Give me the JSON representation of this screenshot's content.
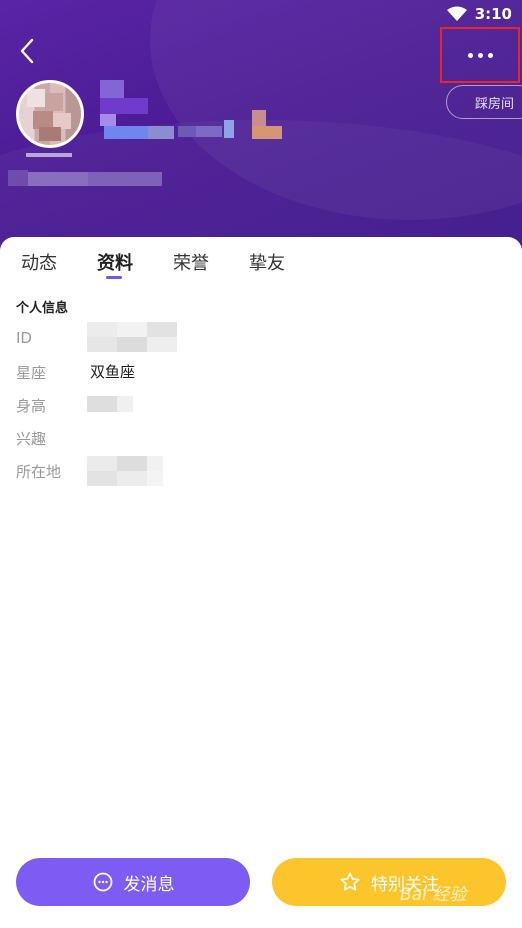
{
  "status_bar": {
    "time": "3:10"
  },
  "header": {
    "room_button_label": "踩房间"
  },
  "tabs": [
    {
      "label": "动态",
      "active": false
    },
    {
      "label": "资料",
      "active": true
    },
    {
      "label": "荣誉",
      "active": false
    },
    {
      "label": "挚友",
      "active": false
    }
  ],
  "profile_info": {
    "section_title": "个人信息",
    "rows": [
      {
        "label": "ID",
        "value": ""
      },
      {
        "label": "星座",
        "value": "双鱼座"
      },
      {
        "label": "身高",
        "value": ""
      },
      {
        "label": "兴趣",
        "value": ""
      },
      {
        "label": "所在地",
        "value": ""
      }
    ]
  },
  "actions": {
    "message_label": "发消息",
    "follow_label": "特别关注"
  },
  "watermark": "Bai 经验",
  "colors": {
    "header_bg": "#4a1c94",
    "accent_purple": "#7d5cf3",
    "follow_yellow": "#fbc52b",
    "highlight_red": "#e8262c"
  },
  "icons": [
    "wifi-icon",
    "back-arrow-icon",
    "more-dots-icon",
    "chat-bubble-icon",
    "star-icon"
  ]
}
